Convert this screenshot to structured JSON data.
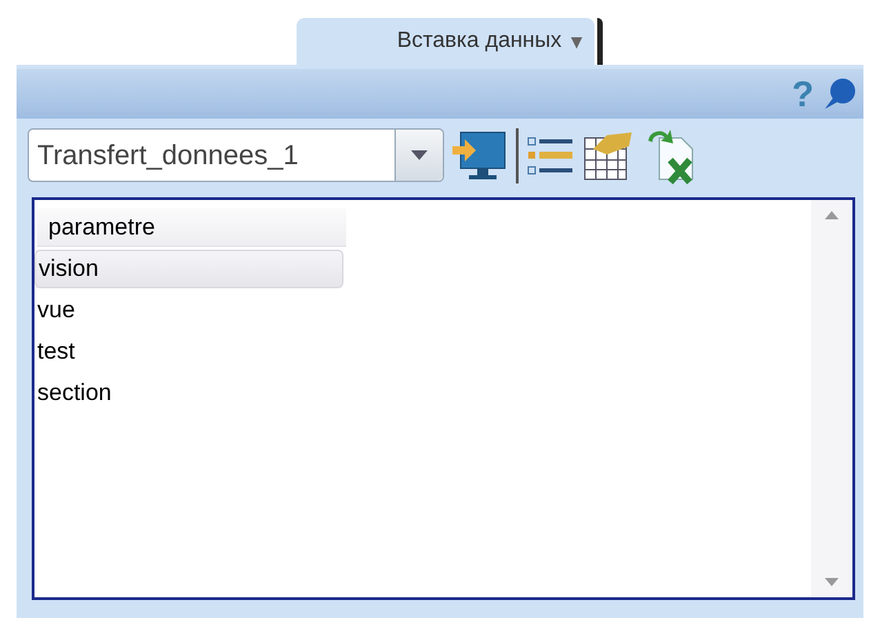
{
  "tab": {
    "label": "Вставка данных",
    "caret": "▼"
  },
  "header": {
    "help": "?"
  },
  "toolbar": {
    "combo_value": "Transfert_donnees_1"
  },
  "list": {
    "items": [
      {
        "label": "parametre",
        "kind": "header",
        "selected": false
      },
      {
        "label": "vision",
        "kind": "item",
        "selected": true
      },
      {
        "label": "vue",
        "kind": "item",
        "selected": false
      },
      {
        "label": "test",
        "kind": "item",
        "selected": false
      },
      {
        "label": "section",
        "kind": "item",
        "selected": false
      }
    ]
  }
}
